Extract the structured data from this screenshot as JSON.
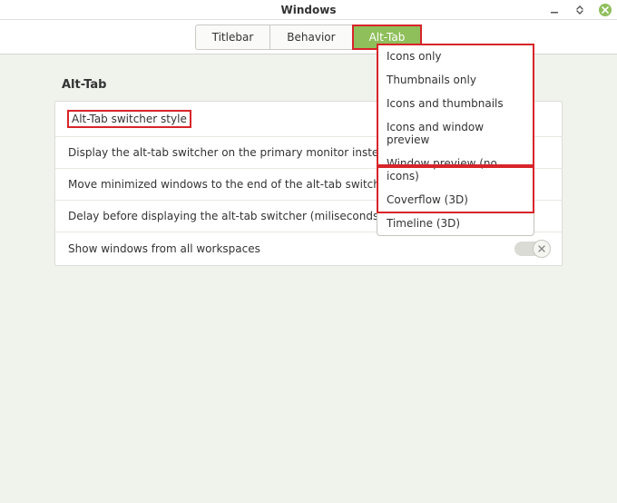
{
  "window": {
    "title": "Windows"
  },
  "tabs": {
    "titlebar": "Titlebar",
    "behavior": "Behavior",
    "alttab": "Alt-Tab"
  },
  "section": {
    "heading": "Alt-Tab"
  },
  "rows": {
    "style": "Alt-Tab switcher style",
    "primary": "Display the alt-tab switcher on the primary monitor instead of the",
    "minimized": "Move minimized windows to the end of the alt-tab switcher",
    "delay": "Delay before displaying the alt-tab switcher (miliseconds)",
    "workspaces": "Show windows from all workspaces"
  },
  "dropdown": {
    "options": {
      "icons_only": "Icons only",
      "thumbs_only": "Thumbnails only",
      "icons_thumbs": "Icons and thumbnails",
      "icons_preview": "Icons and window preview",
      "preview_noicon": "Window preview (no icons)",
      "coverflow": "Coverflow (3D)",
      "timeline": "Timeline (3D)"
    }
  }
}
